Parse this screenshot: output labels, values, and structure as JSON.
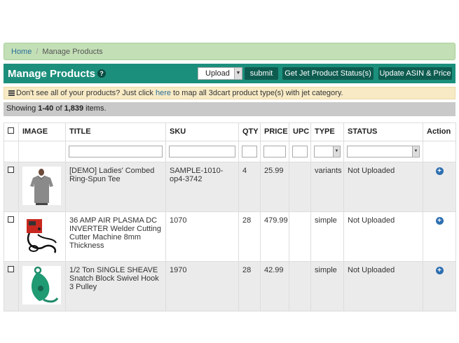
{
  "breadcrumb": {
    "home": "Home",
    "sep": "/",
    "current": "Manage Products"
  },
  "header": {
    "title": "Manage Products",
    "help": "?",
    "upload_select": "Upload",
    "submit": "submit",
    "status_btn": "Get Jet Product Status(s)",
    "update_btn": "Update ASIN & Price"
  },
  "notice": {
    "pre": "Don't see all of your products? Just click ",
    "link": "here",
    "post": " to map all 3dcart product type(s) with jet category."
  },
  "showing": {
    "pre": "Showing ",
    "range": "1-40",
    "mid": " of ",
    "total": "1,839",
    "post": " items."
  },
  "table": {
    "headers": [
      "IMAGE",
      "TITLE",
      "SKU",
      "QTY",
      "PRICE",
      "UPC",
      "TYPE",
      "STATUS",
      "Action"
    ],
    "rows": [
      {
        "title": "[DEMO] Ladies' Combed Ring-Spun Tee",
        "sku": "SAMPLE-1010-op4-3742",
        "qty": "4",
        "price": "25.99",
        "upc": "",
        "type": "variants",
        "status": "Not Uploaded",
        "image_icon": "tshirt-image"
      },
      {
        "title": "36 AMP AIR PLASMA DC INVERTER Welder Cutting Cutter Machine 8mm Thickness",
        "sku": "1070",
        "qty": "28",
        "price": "479.99",
        "upc": "",
        "type": "simple",
        "status": "Not Uploaded",
        "image_icon": "welder-image"
      },
      {
        "title": "1/2 Ton SINGLE SHEAVE Snatch Block Swivel Hook 3 Pulley",
        "sku": "1970",
        "qty": "28",
        "price": "42.99",
        "upc": "",
        "type": "simple",
        "status": "Not Uploaded",
        "image_icon": "snatch-block-image"
      }
    ]
  },
  "colors": {
    "header_bg": "#1c8f7c",
    "breadcrumb_bg": "#c3dfb6",
    "notice_bg": "#f7eac5",
    "action_icon": "#2d6fb0"
  }
}
